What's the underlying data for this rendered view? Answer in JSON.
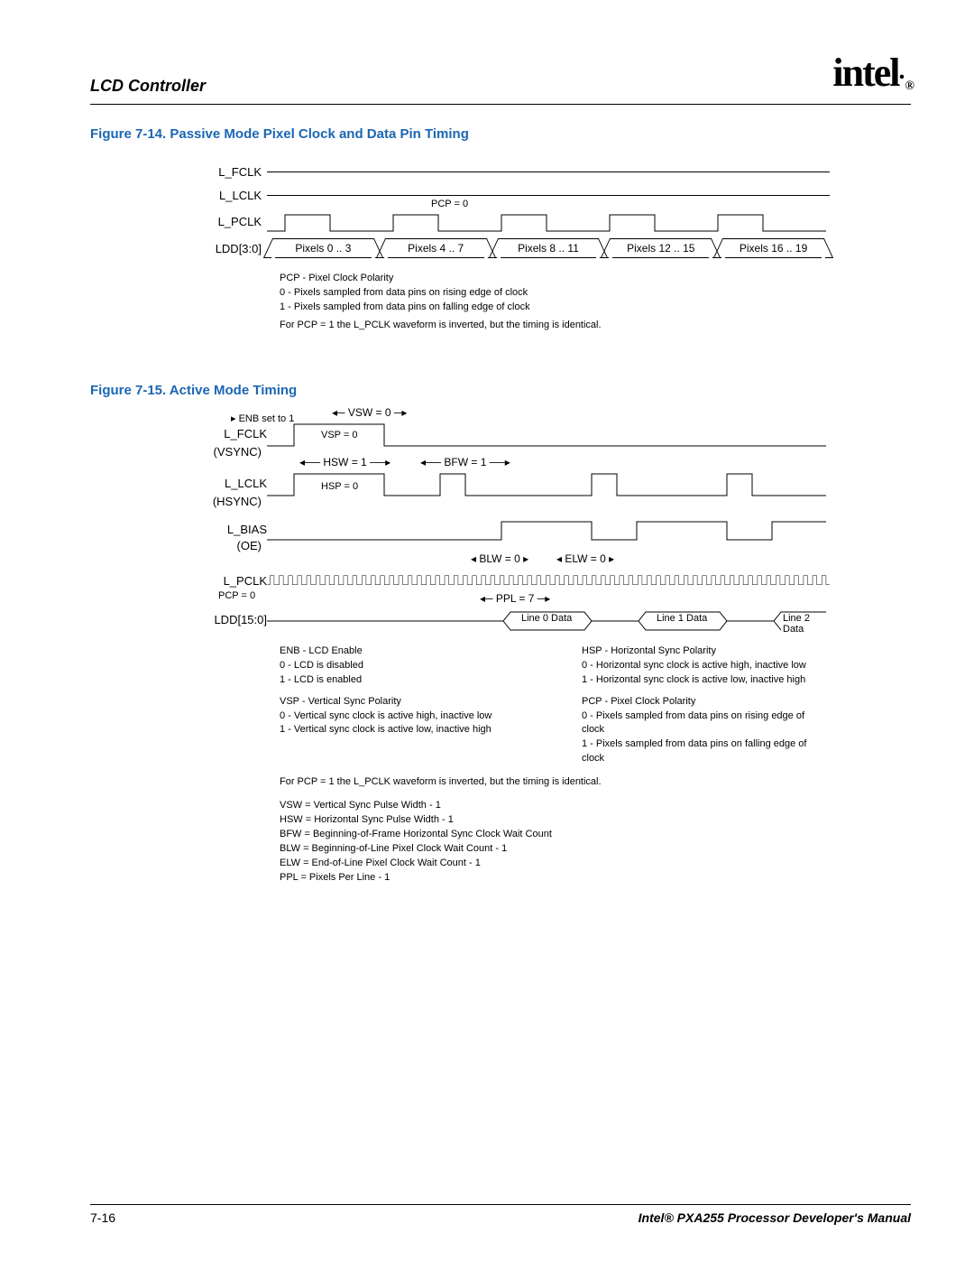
{
  "header": {
    "section": "LCD Controller",
    "logo_text": "intel",
    "logo_trademark": "®"
  },
  "figure1": {
    "title": "Figure 7-14. Passive Mode Pixel Clock and Data Pin Timing",
    "signals": {
      "L_FCLK": "L_FCLK",
      "L_LCLK": "L_LCLK",
      "L_PCLK": "L_PCLK",
      "LDD": "LDD[3:0]"
    },
    "pcp_annot": "PCP = 0",
    "bus_labels": [
      "Pixels 0 .. 3",
      "Pixels 4 .. 7",
      "Pixels 8 .. 11",
      "Pixels 12 .. 15",
      "Pixels 16 .. 19"
    ],
    "notes": [
      "PCP - Pixel Clock Polarity",
      "0 - Pixels sampled from data pins on rising edge of clock",
      "1 - Pixels sampled from data pins on falling edge of clock",
      "For PCP = 1 the L_PCLK waveform is inverted, but the timing is identical."
    ]
  },
  "figure2": {
    "title": "Figure 7-15. Active Mode Timing",
    "signals": {
      "L_FCLK": "L_FCLK",
      "VSYNC": "(VSYNC)",
      "L_LCLK": "L_LCLK",
      "HSYNC": "(HSYNC)",
      "L_BIAS": "L_BIAS",
      "OE": "(OE)",
      "L_PCLK": "L_PCLK",
      "LDD": "LDD[15:0]"
    },
    "annots": {
      "enb": "ENB set to 1",
      "vsw": "VSW = 0",
      "vsp": "VSP = 0",
      "hsw": "HSW = 1",
      "bfw": "BFW = 1",
      "hsp": "HSP = 0",
      "blw": "BLW = 0",
      "elw": "ELW = 0",
      "ppl": "PPL = 7",
      "pcp": "PCP = 0"
    },
    "bus_labels": [
      "Line 0 Data",
      "Line 1 Data",
      "Line 2 Data"
    ],
    "notes_left": [
      "ENB - LCD Enable",
      " 0 - LCD is disabled",
      " 1 - LCD is enabled",
      "",
      "VSP - Vertical Sync Polarity",
      " 0 - Vertical sync clock is active high, inactive low",
      " 1 - Vertical sync clock is active low, inactive high"
    ],
    "notes_right": [
      "HSP - Horizontal Sync Polarity",
      " 0 - Horizontal sync clock is active high, inactive low",
      " 1 - Horizontal sync clock is active low, inactive high",
      "",
      "PCP - Pixel Clock Polarity",
      " 0 - Pixels sampled from data pins on rising edge of clock",
      " 1 - Pixels sampled from data pins on falling edge of clock"
    ],
    "note_pcp": "For PCP = 1 the L_PCLK waveform is inverted, but the timing is identical.",
    "defs": [
      "VSW = Vertical Sync Pulse Width - 1",
      "HSW = Horizontal Sync Pulse Width - 1",
      "BFW = Beginning-of-Frame Horizontal Sync Clock Wait Count",
      "BLW = Beginning-of-Line Pixel Clock Wait Count - 1",
      "ELW = End-of-Line Pixel Clock Wait Count - 1",
      "PPL = Pixels Per Line - 1"
    ]
  },
  "footer": {
    "pageno": "7-16",
    "manual": "Intel® PXA255 Processor Developer's Manual"
  }
}
